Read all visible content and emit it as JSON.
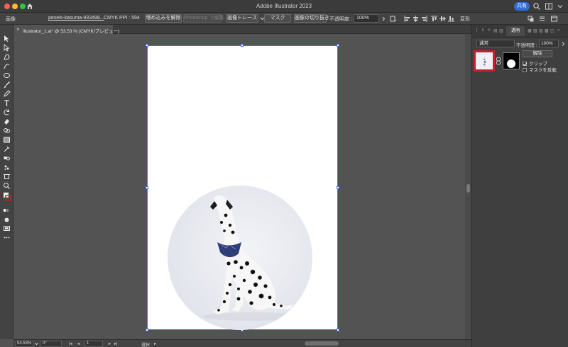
{
  "window": {
    "title": "Adobe Illustrator 2023",
    "share_label": "共有"
  },
  "control_bar": {
    "object_type": "画像",
    "file_name": "pexels-kasuma-933498...",
    "color_mode": "CMYK",
    "ppi": "PPI : 594",
    "embed_button": "埋め込みを解除",
    "photoshop_button": "Photoshop で編集",
    "trace_button": "画像トレース",
    "mask_button": "マスク",
    "crop_button": "画像の切り抜き",
    "opacity_label": "不透明度 :",
    "opacity_value": "100%",
    "transform_label": "変形"
  },
  "document": {
    "tab_label": "illustrator_1.ai* @ 53.53 % (CMYK/プレビュー)",
    "close_glyph": "×"
  },
  "status_bar": {
    "zoom": "53.53%",
    "rotation": "0°",
    "artboard": "1",
    "tool": "選択"
  },
  "transparency_panel": {
    "tab_label": "透明",
    "blend_mode": "通常",
    "opacity_label": "不透明度 :",
    "opacity_value": "100%",
    "release_button": "解除",
    "clip_label": "クリップ",
    "clip_checked": true,
    "invert_label": "マスクを反転",
    "invert_checked": false
  },
  "colors": {
    "accent": "#2c6fd6",
    "highlight": "#c8202c",
    "selection": "#4a6fd6"
  }
}
